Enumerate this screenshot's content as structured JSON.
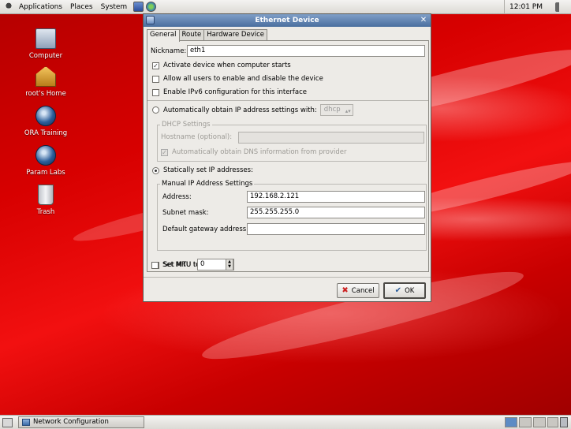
{
  "top_panel": {
    "menus": [
      "Applications",
      "Places",
      "System"
    ],
    "clock": "12:01 PM"
  },
  "desktop_icons": [
    {
      "label": "Computer",
      "icon": "computer-icon"
    },
    {
      "label": "root's Home",
      "icon": "home-folder-icon"
    },
    {
      "label": "ORA Training",
      "icon": "globe-icon"
    },
    {
      "label": "Param Labs",
      "icon": "globe-icon"
    },
    {
      "label": "Trash",
      "icon": "trash-icon"
    }
  ],
  "dialog": {
    "title": "Ethernet Device",
    "tabs": [
      "General",
      "Route",
      "Hardware Device"
    ],
    "nickname_label": "Nickname:",
    "nickname_value": "eth1",
    "activate_label": "Activate device when computer starts",
    "activate_checked": true,
    "allow_users_label": "Allow all users to enable and disable the device",
    "ipv6_label": "Enable IPv6 configuration for this interface",
    "auto_obtain_label": "Automatically obtain IP address settings with:",
    "auto_obtain_method": "dhcp",
    "dhcp_group_label": "DHCP Settings",
    "hostname_label": "Hostname (optional):",
    "auto_dns_label": "Automatically obtain DNS information from provider",
    "static_label": "Statically set IP addresses:",
    "manual_group_label": "Manual IP Address Settings",
    "address_label": "Address:",
    "address_value": "192.168.2.121",
    "subnet_label": "Subnet mask:",
    "subnet_value": "255.255.255.0",
    "gateway_label": "Default gateway address:",
    "gateway_value": "",
    "mtu_label": "Set MTU to:",
    "mtu_value": "0",
    "mru_label": "Set MRU to:",
    "mru_value": "0",
    "cancel_label": "Cancel",
    "ok_label": "OK"
  },
  "bottom_panel": {
    "task_label": "Network Configuration"
  }
}
